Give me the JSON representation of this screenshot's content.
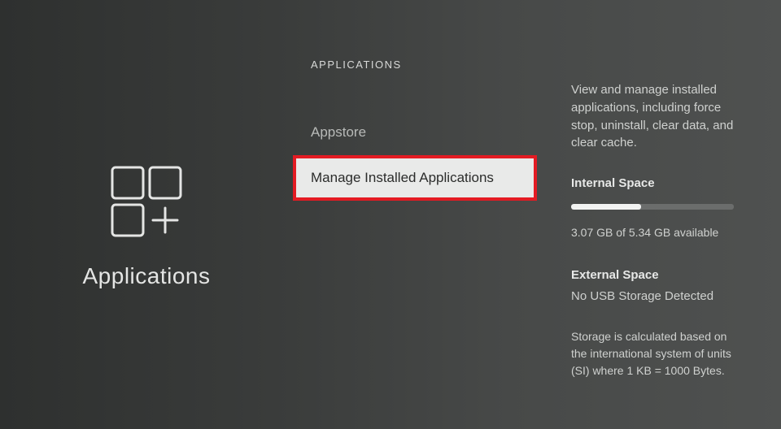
{
  "sidebar": {
    "title": "Applications"
  },
  "breadcrumb": "APPLICATIONS",
  "menu": {
    "items": [
      {
        "label": "Appstore"
      },
      {
        "label": "Manage Installed Applications"
      }
    ]
  },
  "info": {
    "description": "View and manage installed applications, including force stop, uninstall, clear data, and clear cache.",
    "internal": {
      "heading": "Internal Space",
      "available": "3.07 GB of 5.34 GB available",
      "fill_percent": 43
    },
    "external": {
      "heading": "External Space",
      "status": "No USB Storage Detected"
    },
    "note": "Storage is calculated based on the international system of units (SI) where 1 KB = 1000 Bytes."
  }
}
